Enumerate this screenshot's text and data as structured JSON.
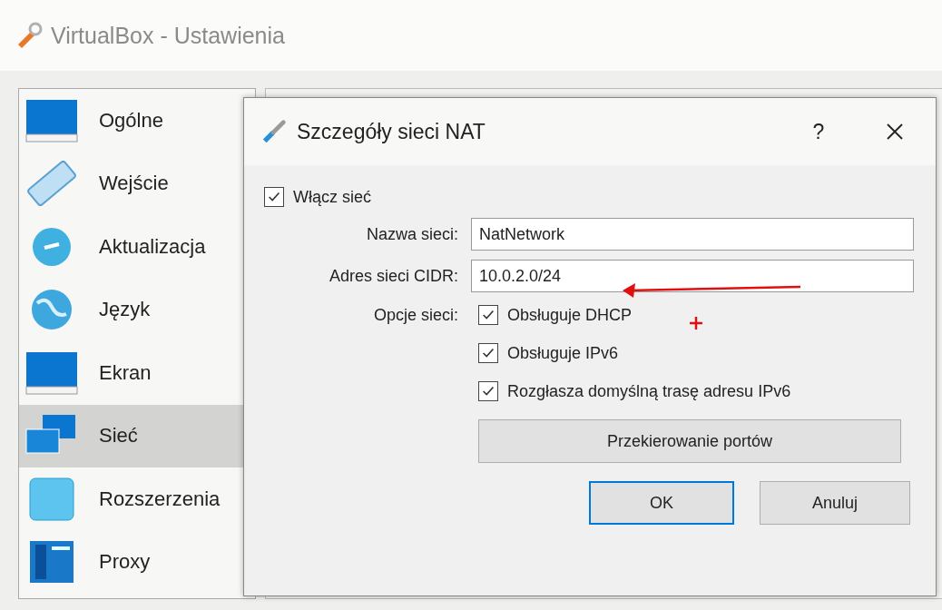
{
  "window": {
    "title": "VirtualBox - Ustawienia"
  },
  "sidebar": {
    "items": [
      {
        "label": "Ogólne",
        "selected": false
      },
      {
        "label": "Wejście",
        "selected": false
      },
      {
        "label": "Aktualizacja",
        "selected": false
      },
      {
        "label": "Język",
        "selected": false
      },
      {
        "label": "Ekran",
        "selected": false
      },
      {
        "label": "Sieć",
        "selected": true
      },
      {
        "label": "Rozszerzenia",
        "selected": false
      },
      {
        "label": "Proxy",
        "selected": false
      }
    ]
  },
  "dialog": {
    "title": "Szczegóły sieci NAT",
    "help": "?",
    "enable_network": {
      "label": "Włącz sieć",
      "checked": true
    },
    "fields": [
      {
        "label": "Nazwa sieci:",
        "value": "NatNetwork"
      },
      {
        "label": "Adres sieci CIDR:",
        "value": "10.0.2.0/24"
      }
    ],
    "options": {
      "label": "Opcje sieci:",
      "items": [
        {
          "label": "Obsługuje DHCP",
          "checked": true
        },
        {
          "label": "Obsługuje IPv6",
          "checked": true
        },
        {
          "label": "Rozgłasza domyślną trasę adresu IPv6",
          "checked": true
        }
      ]
    },
    "port_forwarding_button": "Przekierowanie portów",
    "buttons": [
      {
        "label": "OK",
        "default": true
      },
      {
        "label": "Anuluj",
        "default": false
      }
    ]
  }
}
